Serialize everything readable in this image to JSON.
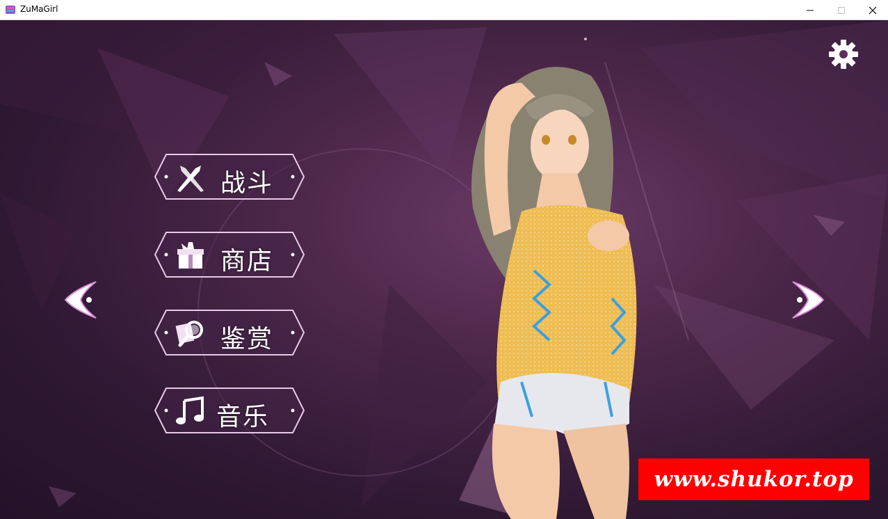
{
  "window": {
    "title": "ZuMaGirl",
    "icon": "app-logo-icon",
    "controls": [
      "minimize-icon",
      "maximize-icon",
      "close-icon"
    ]
  },
  "menu": {
    "items": [
      {
        "label": "战斗",
        "icon": "crossed-swords-icon"
      },
      {
        "label": "商店",
        "icon": "gift-box-icon"
      },
      {
        "label": "鉴赏",
        "icon": "magnifier-gallery-icon"
      },
      {
        "label": "音乐",
        "icon": "music-note-icon"
      }
    ]
  },
  "navigation": {
    "prev_icon": "chevron-left-icon",
    "next_icon": "chevron-right-icon"
  },
  "settings": {
    "icon": "gear-icon"
  },
  "watermark": {
    "text": "www.shukor.top"
  },
  "colors": {
    "background_dark": "#2e1832",
    "background_mid": "#6a3a66",
    "button_border": "#e8c9ea",
    "watermark_red": "#ff0000"
  }
}
